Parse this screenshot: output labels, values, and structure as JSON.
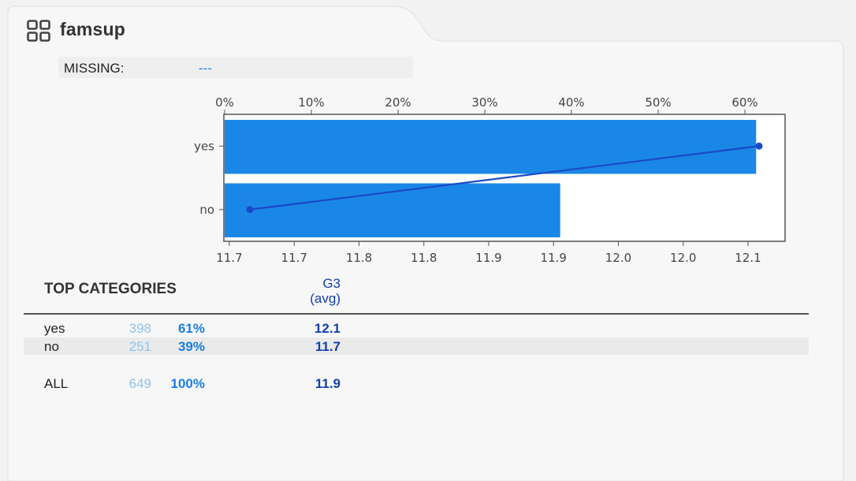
{
  "header": {
    "title": "famsup",
    "icon": "grid-icon"
  },
  "missing": {
    "label": "MISSING:",
    "value": "---"
  },
  "chart_data": {
    "type": "bar",
    "orientation": "horizontal",
    "categories": [
      "yes",
      "no"
    ],
    "series": [
      {
        "values": [
          61.3,
          38.7
        ],
        "axis": "top",
        "unit": "%"
      },
      {
        "values": [
          12.1,
          11.7
        ],
        "axis": "bottom",
        "kind": "line"
      }
    ],
    "top_axis": {
      "ticks": [
        "0%",
        "10%",
        "20%",
        "30%",
        "40%",
        "50%",
        "60%"
      ],
      "range": [
        0,
        65
      ]
    },
    "bottom_axis": {
      "ticks": [
        "11.7",
        "11.7",
        "11.8",
        "11.8",
        "11.9",
        "11.9",
        "12.0",
        "12.0",
        "12.1"
      ]
    },
    "colors": {
      "bar": "#1a87e6",
      "line": "#1a49c8"
    }
  },
  "table": {
    "title": "TOP CATEGORIES",
    "metric_header_line1": "G3",
    "metric_header_line2": "(avg)",
    "rows": [
      {
        "name": "yes",
        "count": "398",
        "pct": "61%",
        "avg": "12.1"
      },
      {
        "name": "no",
        "count": "251",
        "pct": "39%",
        "avg": "11.7"
      }
    ],
    "total": {
      "name": "ALL",
      "count": "649",
      "pct": "100%",
      "avg": "11.9"
    }
  }
}
